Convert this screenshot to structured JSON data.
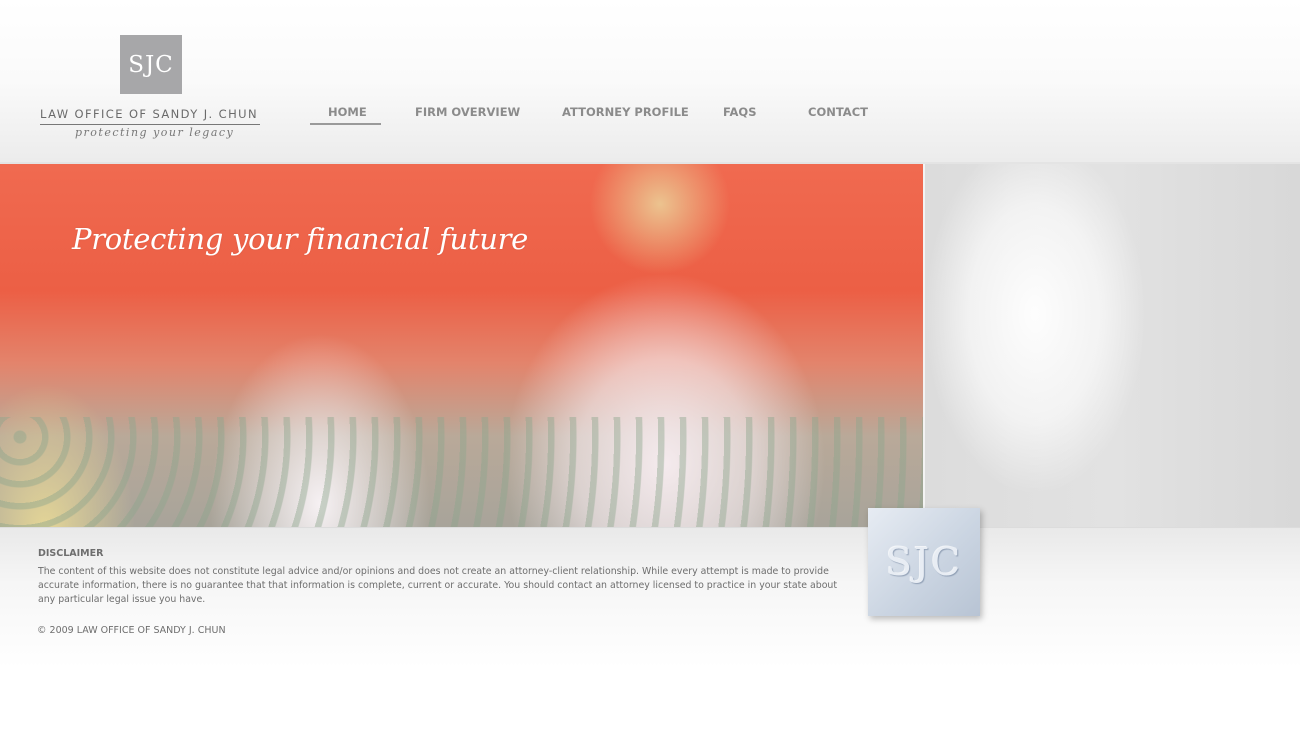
{
  "header": {
    "logo_monogram": "SJC",
    "firm_name": "LAW OFFICE OF SANDY J. CHUN",
    "tagline": "protecting your legacy"
  },
  "nav": {
    "items": [
      {
        "label": "HOME",
        "active": true
      },
      {
        "label": "FIRM OVERVIEW",
        "active": false
      },
      {
        "label": "ATTORNEY PROFILE",
        "active": false
      },
      {
        "label": "FAQS",
        "active": false
      },
      {
        "label": "CONTACT",
        "active": false
      }
    ]
  },
  "hero": {
    "caption": "Protecting your financial future"
  },
  "footer": {
    "disclaimer_title": "DISCLAIMER",
    "disclaimer_text": "The content of this website does not constitute legal advice and/or opinions and does not create an attorney-client relationship.  While every attempt is made to provide accurate information, there is no guarantee that that information is complete, current or accurate.  You should contact an attorney licensed to practice in your state about any particular legal issue you have.",
    "copyright": "© 2009 LAW OFFICE OF SANDY J. CHUN",
    "badge_monogram": "SJC"
  },
  "colors": {
    "logo_gray": "#a7a7a9",
    "nav_text": "#8b8b8b",
    "body_text": "#6e6e6e",
    "badge_blue": "#cbd5e2"
  }
}
